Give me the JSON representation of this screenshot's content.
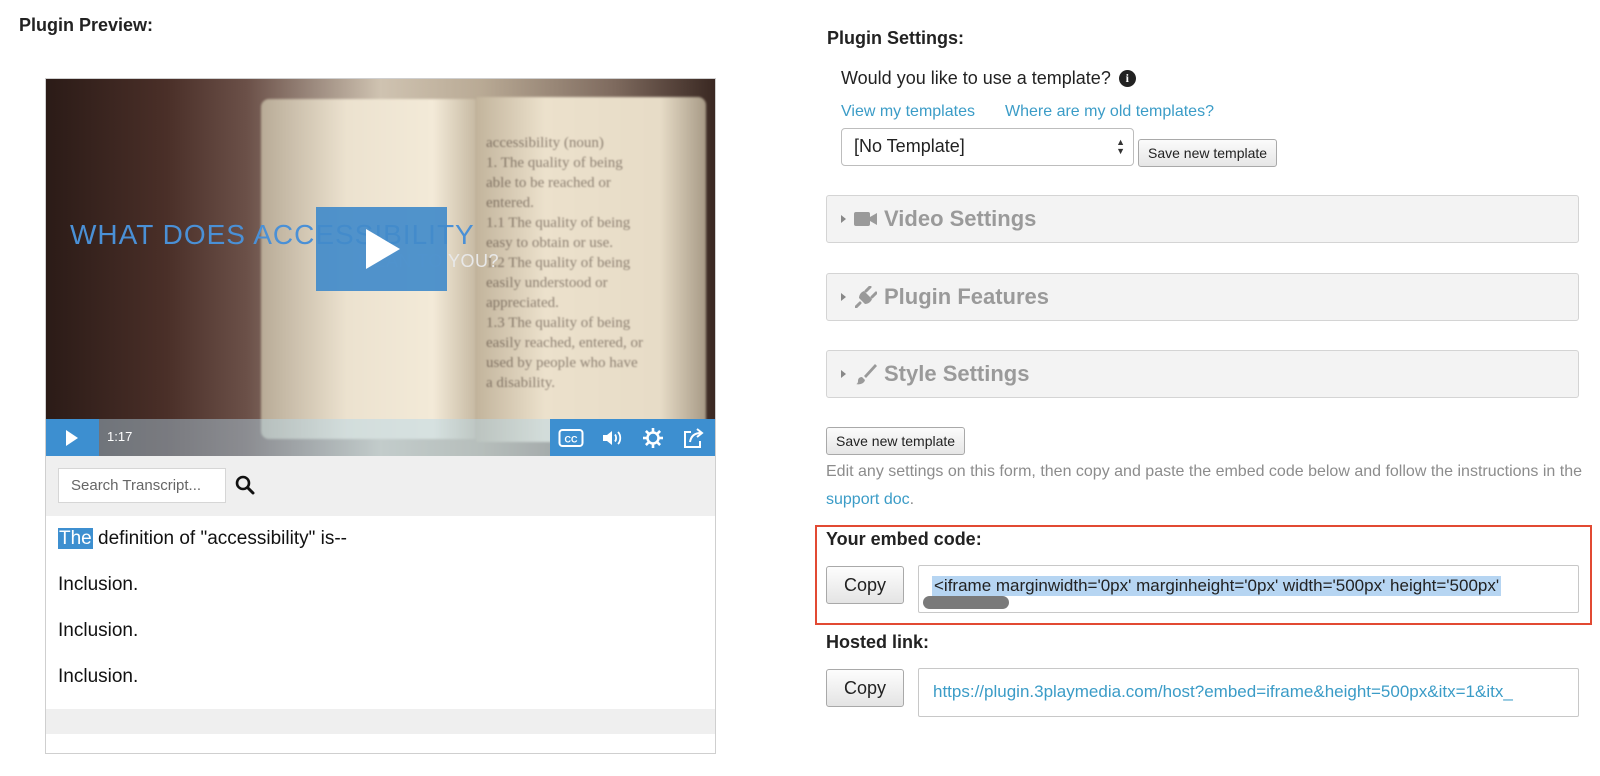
{
  "preview": {
    "title": "Plugin Preview:",
    "video": {
      "title_line1": "WHAT DOES ACCESSIBILITY",
      "title_line2": "MEAN TO YOU?",
      "book_text": "accessibility (noun)\n1. The quality of being\nable to be reached or\nentered.\n1.1 The quality of being\neasy to obtain or use.\n1.2 The quality of being\neasily understood or\nappreciated.\n1.3 The quality of being\neasily reached, entered, or\nused by people who have\na disability.",
      "time": "1:17",
      "accent_color": "#3d8fd0"
    },
    "search": {
      "placeholder": "Search Transcript..."
    },
    "transcript": {
      "line1_highlight": "The",
      "line1_rest": " definition of \"accessibility\" is--",
      "line2": "Inclusion.",
      "line3": "Inclusion.",
      "line4": "Inclusion."
    }
  },
  "settings": {
    "title": "Plugin Settings:",
    "template_question": "Would you like to use a template?",
    "view_templates_link": "View my templates",
    "old_templates_link": "Where are my old templates?",
    "template_select_value": "[No Template]",
    "save_template_label": "Save new template",
    "panels": {
      "video": "Video Settings",
      "features": "Plugin Features",
      "style": "Style Settings"
    },
    "instructions_prefix": "Edit any settings on this form, then copy and paste the embed code below and follow the instructions in the ",
    "support_link": "support doc",
    "instructions_suffix": ".",
    "embed_label": "Your embed code:",
    "copy_label": "Copy",
    "embed_code": "<iframe marginwidth='0px' marginheight='0px' width='500px' height='500px'",
    "hosted_label": "Hosted link:",
    "hosted_link": "https://plugin.3playmedia.com/host?embed=iframe&height=500px&itx=1&itx_",
    "link_color": "#3b9cc7",
    "highlight_border_color": "#e24a33"
  }
}
